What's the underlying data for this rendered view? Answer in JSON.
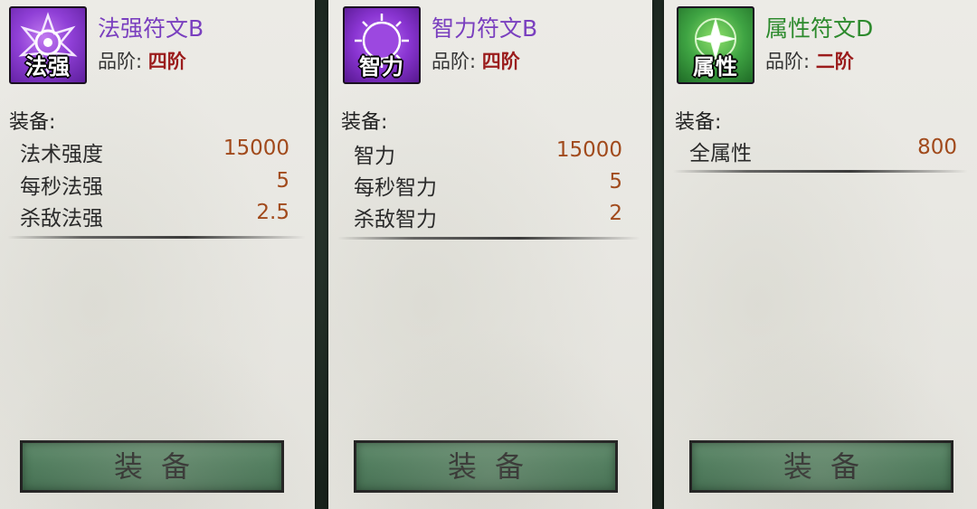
{
  "cards": [
    {
      "icon": {
        "name": "spell-power-rune-icon",
        "label": "法强",
        "color": "#8a3fd1"
      },
      "name": "法强符文B",
      "grade_label": "品阶:",
      "grade_value": "四阶",
      "equip_title": "装备:",
      "stats": [
        {
          "name": "法术强度",
          "value": "15000"
        },
        {
          "name": "每秒法强",
          "value": "5"
        },
        {
          "name": "杀敌法强",
          "value": "2.5"
        }
      ],
      "button_label": "装备"
    },
    {
      "icon": {
        "name": "intelligence-rune-icon",
        "label": "智力",
        "color": "#8a3fd1"
      },
      "name": "智力符文B",
      "grade_label": "品阶:",
      "grade_value": "四阶",
      "equip_title": "装备:",
      "stats": [
        {
          "name": "智力",
          "value": "15000"
        },
        {
          "name": "每秒智力",
          "value": "5"
        },
        {
          "name": "杀敌智力",
          "value": "2"
        }
      ],
      "button_label": "装备"
    },
    {
      "icon": {
        "name": "attribute-rune-icon",
        "label": "属性",
        "color": "#2f9a3a"
      },
      "name": "属性符文D",
      "grade_label": "品阶:",
      "grade_value": "二阶",
      "equip_title": "装备:",
      "stats": [
        {
          "name": "全属性",
          "value": "800"
        }
      ],
      "button_label": "装备"
    }
  ]
}
